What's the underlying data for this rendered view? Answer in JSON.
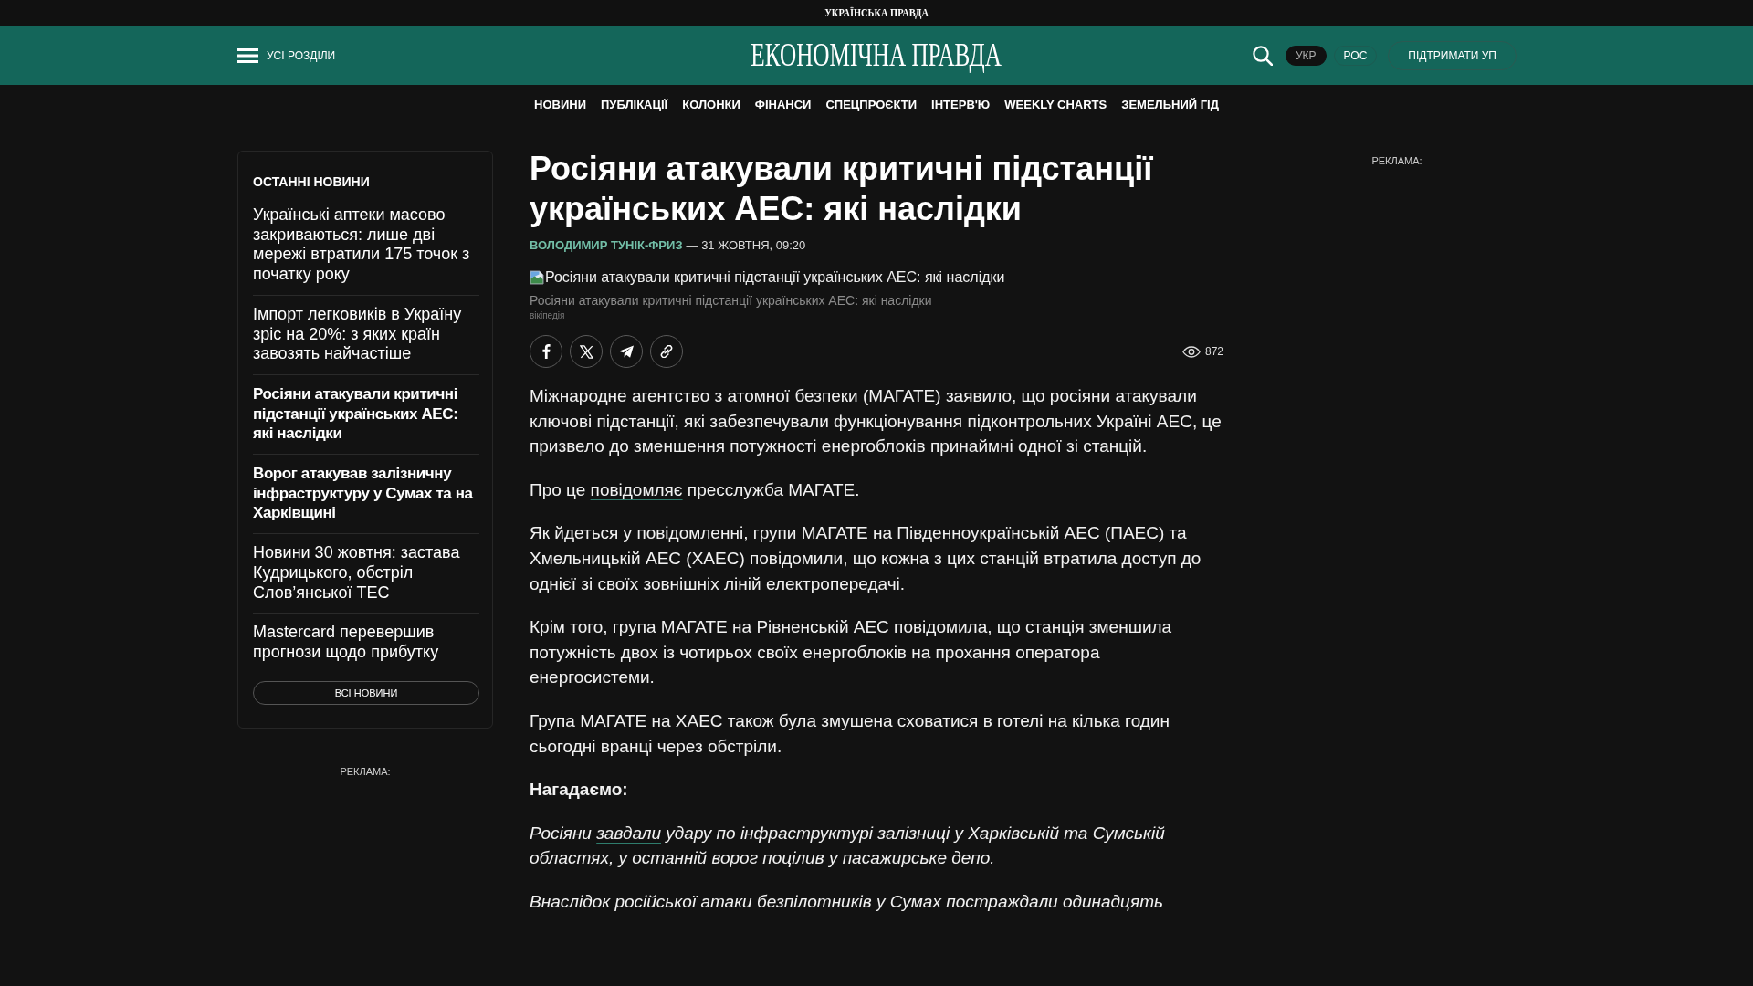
{
  "top_bar": {
    "site_name": "УКРАЇНСЬКА ПРАВДА"
  },
  "header": {
    "menu_label": "УСІ РОЗДІЛИ",
    "logo": "ЕКОНОМІЧНА ПРАВДА",
    "languages": [
      {
        "label": "УКР",
        "selected": true
      },
      {
        "label": "РОС",
        "selected": false
      }
    ],
    "support_button": "ПІДТРИМАТИ УП"
  },
  "nav": [
    "НОВИНИ",
    "ПУБЛІКАЦІЇ",
    "КОЛОНКИ",
    "ФІНАНСИ",
    "СПЕЦПРОЄКТИ",
    "ІНТЕРВ'Ю",
    "WEEKLY CHARTS",
    "ЗЕМЕЛЬНИЙ ГІД"
  ],
  "sidebar": {
    "title": "ОСТАННІ НОВИНИ",
    "items": [
      {
        "text": "Українські аптеки масово закриваються: лише дві мережі втратили 175 точок з початку року",
        "emphasized": false
      },
      {
        "text": "Імпорт легковиків в Україну зріс на 20%: з яких країн завозять найчастіше",
        "emphasized": false
      },
      {
        "text": "Росіяни атакували критичні підстанції українських АЕС: які наслідки",
        "emphasized": true
      },
      {
        "text": "Ворог атакував залізничну інфраструктуру у Сумах та на Харківщині",
        "emphasized": true
      },
      {
        "text": "Новини 30 жовтня: застава Кудрицького, обстріл Слов’янської ТЕС",
        "emphasized": false
      },
      {
        "text": "Mastercard перевершив прогнози щодо прибутку",
        "emphasized": false
      }
    ],
    "all_news_button": "ВСІ НОВИНИ",
    "ad_label": "РЕКЛАМА:"
  },
  "article": {
    "title": "Росіяни атакували критичні підстанції українських АЕС: які наслідки",
    "author": "ВОЛОДИМИР ТУНІК-ФРИЗ",
    "date": "— 31 ЖОВТНЯ, 09:20",
    "image_alt": "Росіяни атакували критичні підстанції українських АЕС: які наслідки",
    "caption": "Росіяни атакували критичні підстанції українських АЕС: які наслідки",
    "credit": "вікіпедія",
    "share_buttons": [
      {
        "kind": "facebook"
      },
      {
        "kind": "x"
      },
      {
        "kind": "telegram"
      },
      {
        "kind": "copy_link"
      }
    ],
    "views": "872",
    "body": [
      {
        "kind": "paragraph",
        "parts": [
          {
            "kind": "text",
            "text": "Міжнародне агентство з атомної безпеки (МАГАТЕ) заявило, що росіяни атакували ключові підстанції, які забезпечували функціонування підконтрольних Україні АЕС, це призвело до зменшення потужності енергоблоків принаймні одної зі станцій."
          }
        ]
      },
      {
        "kind": "paragraph",
        "parts": [
          {
            "kind": "text",
            "text": "Про це "
          },
          {
            "kind": "link",
            "text": "повідомляє"
          },
          {
            "kind": "text",
            "text": " пресслужба МАГАТЕ."
          }
        ]
      },
      {
        "kind": "paragraph",
        "parts": [
          {
            "kind": "text",
            "text": "Як йдеться у повідомленні, групи МАГАТЕ на Південноукраїнській АЕС (ПАЕС) та Хмельницькій АЕС (ХАЕС) повідомили, що кожна з цих станцій втратила доступ до однієї зі своїх зовнішніх ліній електропередачі."
          }
        ]
      },
      {
        "kind": "paragraph",
        "parts": [
          {
            "kind": "text",
            "text": "Крім того, група МАГАТЕ на Рівненській АЕС повідомила, що станція зменшила потужність двох із чотирьох своїх енергоблоків на прохання оператора енергосистеми."
          }
        ]
      },
      {
        "kind": "paragraph",
        "parts": [
          {
            "kind": "text",
            "text": "Група МАГАТЕ на ХАЕС також була змушена сховатися в готелі на кілька годин сьогодні вранці через обстріли."
          }
        ]
      },
      {
        "kind": "subheading",
        "parts": [
          {
            "kind": "text",
            "text": "Нагадаємо:"
          }
        ]
      },
      {
        "kind": "quote",
        "parts": [
          {
            "kind": "text",
            "text": "Росіяни "
          },
          {
            "kind": "link",
            "text": "завдали"
          },
          {
            "kind": "text",
            "text": " удару по інфраструктурі залізниці у Харківській та Сумській областях, у останній ворог поцілив у пасажирське депо."
          }
        ]
      },
      {
        "kind": "quote",
        "parts": [
          {
            "kind": "text",
            "text": "Внаслідок російської атаки безпілотників у Сумах постраждали одинадцять"
          }
        ]
      }
    ]
  },
  "right_column": {
    "ad_label": "РЕКЛАМА:"
  }
}
